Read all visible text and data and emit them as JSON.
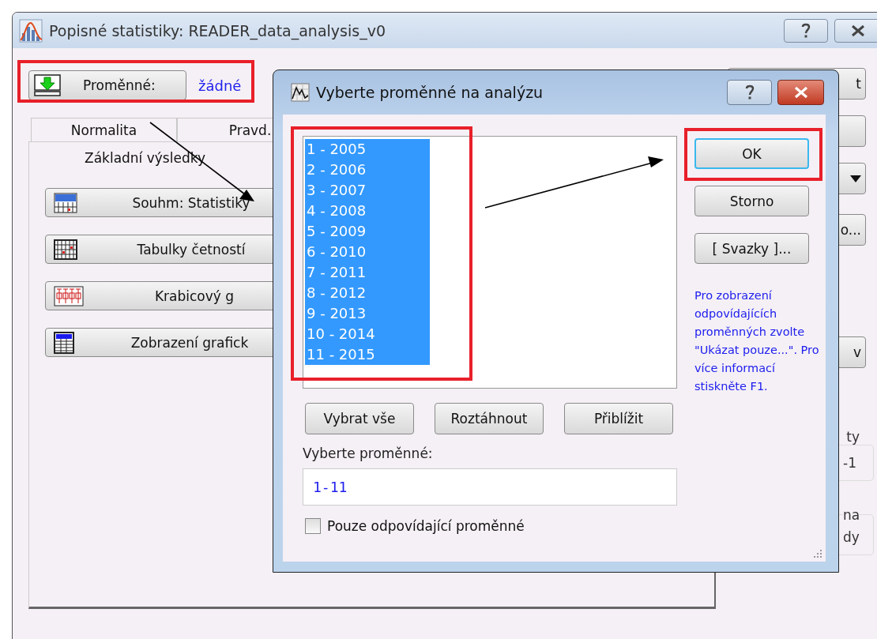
{
  "window": {
    "title": "Popisné statistiky: READER_data_analysis_v0"
  },
  "variables": {
    "label": "Proměnné:",
    "value": "žádné"
  },
  "tab_rows": [
    [
      {
        "label": "Normalita",
        "selected": false
      },
      {
        "label": "Pravd.",
        "selected": false
      }
    ],
    [
      {
        "label": "Základní výsledky",
        "selected": true
      }
    ]
  ],
  "actions": [
    {
      "label": "Souhm: Statistiky",
      "kind": "summary"
    },
    {
      "label": "Tabulky četností",
      "kind": "frequency"
    },
    {
      "label": "Krabicový g",
      "kind": "boxplot"
    },
    {
      "label": "Zobrazení grafick",
      "kind": "grid"
    }
  ],
  "side": [
    {
      "kind": "button",
      "label": "t"
    },
    {
      "kind": "blank"
    },
    {
      "kind": "dropdown"
    },
    {
      "kind": "button",
      "label": "o..."
    },
    {
      "kind": "button",
      "label": "v"
    },
    {
      "kind": "text",
      "label": "ty"
    },
    {
      "kind": "group",
      "lines": [
        "-1"
      ]
    },
    {
      "kind": "group",
      "title": "na",
      "lines": [
        "dy"
      ]
    }
  ],
  "dialog": {
    "title": "Vyberte proměnné na analýzu",
    "items": [
      {
        "label": "1 - 2005",
        "selected": true
      },
      {
        "label": "2 - 2006",
        "selected": true
      },
      {
        "label": "3 - 2007",
        "selected": true
      },
      {
        "label": "4 - 2008",
        "selected": true
      },
      {
        "label": "5 - 2009",
        "selected": true
      },
      {
        "label": "6 - 2010",
        "selected": true
      },
      {
        "label": "7 - 2011",
        "selected": true
      },
      {
        "label": "8 - 2012",
        "selected": true
      },
      {
        "label": "9 - 2013",
        "selected": true
      },
      {
        "label": "10 - 2014",
        "selected": true
      },
      {
        "label": "11 - 2015",
        "selected": true
      }
    ],
    "buttons": [
      {
        "label": "OK",
        "focused": true
      },
      {
        "label": "Storno",
        "focused": false
      },
      {
        "label": "[ Svazky ]...",
        "focused": false
      }
    ],
    "help": "Pro zobrazení odpovídajících proměnných zvolte \"Ukázat pouze...\". Pro více informací stiskněte F1.",
    "list_buttons": [
      "Vybrat vše",
      "Roztáhnout",
      "Přiblížit"
    ],
    "field": {
      "label": "Vyberte proměnné:",
      "value": "1-11"
    },
    "checkbox": {
      "label": "Pouze odpovídající proměnné",
      "checked": false
    }
  }
}
